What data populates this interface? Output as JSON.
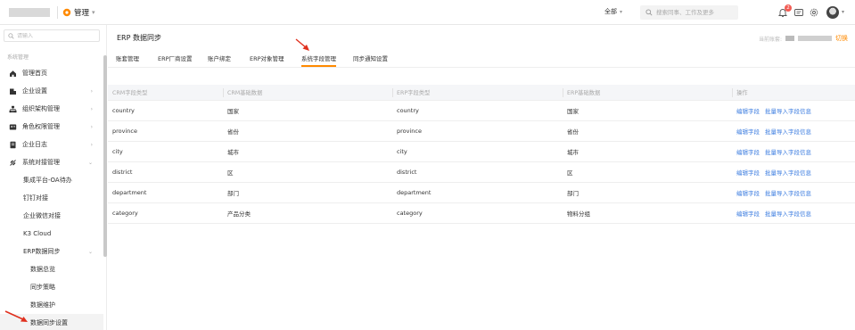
{
  "header": {
    "app_title": "管理",
    "scope_label": "全部",
    "search_placeholder": "搜索同事、工作及更多",
    "notification_count": "2"
  },
  "sidebar": {
    "search_placeholder": "请输入",
    "section_label": "系统管理",
    "items": [
      {
        "label": "管理首页"
      },
      {
        "label": "企业设置"
      },
      {
        "label": "组织架构管理"
      },
      {
        "label": "角色权限管理"
      },
      {
        "label": "企业日志"
      },
      {
        "label": "系统对接管理"
      },
      {
        "label": "集成平台-OA待办"
      },
      {
        "label": "钉钉对接"
      },
      {
        "label": "企业微信对接"
      },
      {
        "label": "K3 Cloud"
      },
      {
        "label": "ERP数据同步"
      },
      {
        "label": "数据总览"
      },
      {
        "label": "同步策略"
      },
      {
        "label": "数据维护"
      },
      {
        "label": "数据同步设置"
      }
    ]
  },
  "main": {
    "page_title": "ERP 数据同步",
    "tenant_label": "当前账套:",
    "switch_label": "切换",
    "tabs": [
      {
        "label": "账套管理"
      },
      {
        "label": "ERP厂商设置"
      },
      {
        "label": "账户绑定"
      },
      {
        "label": "ERP对象管理"
      },
      {
        "label": "系统字段管理"
      },
      {
        "label": "同步通知设置"
      }
    ],
    "table": {
      "headers": [
        "CRM字段类型",
        "CRM基础数据",
        "ERP字段类型",
        "ERP基础数据",
        "操作"
      ],
      "rows": [
        {
          "crm_type": "country",
          "crm_data": "国家",
          "erp_type": "country",
          "erp_data": "国家"
        },
        {
          "crm_type": "province",
          "crm_data": "省份",
          "erp_type": "province",
          "erp_data": "省份"
        },
        {
          "crm_type": "city",
          "crm_data": "城市",
          "erp_type": "city",
          "erp_data": "城市"
        },
        {
          "crm_type": "district",
          "crm_data": "区",
          "erp_type": "district",
          "erp_data": "区"
        },
        {
          "crm_type": "department",
          "crm_data": "部门",
          "erp_type": "department",
          "erp_data": "部门"
        },
        {
          "crm_type": "category",
          "crm_data": "产品分类",
          "erp_type": "category",
          "erp_data": "物料分组"
        }
      ],
      "actions": {
        "edit": "编辑字段",
        "import": "批量导入字段信息"
      }
    }
  },
  "colors": {
    "accent": "#ff8a00",
    "link": "#3d7de0",
    "annotation_arrow": "#e0301e",
    "badge": "#f25c54"
  }
}
